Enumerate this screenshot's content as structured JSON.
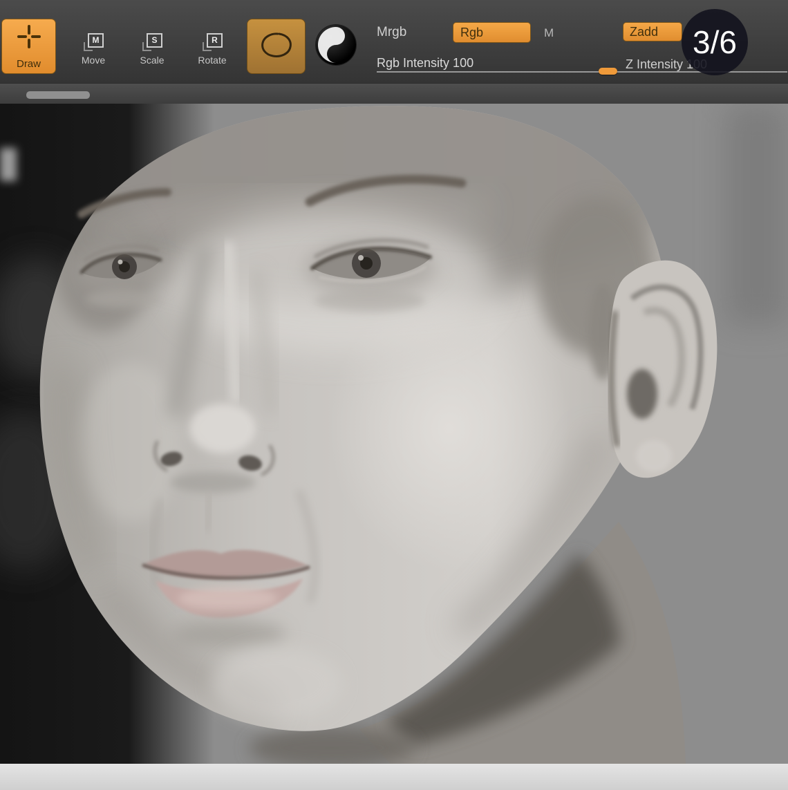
{
  "overlay": {
    "page_indicator": "3/6"
  },
  "toolbar": {
    "tools": [
      {
        "id": "draw",
        "label": "Draw",
        "active": true
      },
      {
        "id": "move",
        "label": "Move",
        "badge": "M"
      },
      {
        "id": "scale",
        "label": "Scale",
        "badge": "S"
      },
      {
        "id": "rotate",
        "label": "Rotate",
        "badge": "R"
      }
    ],
    "paint": {
      "mrgb_label": "Mrgb",
      "rgb_button_label": "Rgb",
      "m_label": "M",
      "rgb_intensity_label": "Rgb Intensity 100"
    },
    "sculpt": {
      "zadd_button_label": "Zadd",
      "z_intensity_label": "Z Intensity 100"
    }
  },
  "colors": {
    "accent_orange": "#ee9a3c",
    "toolbar_bg": "#3f3f3f",
    "canvas_bg": "#8d8d8d",
    "badge_bg": "#12121c"
  },
  "canvas": {
    "content": "3D sculpted head, three-quarter view, matte gray clay material"
  }
}
